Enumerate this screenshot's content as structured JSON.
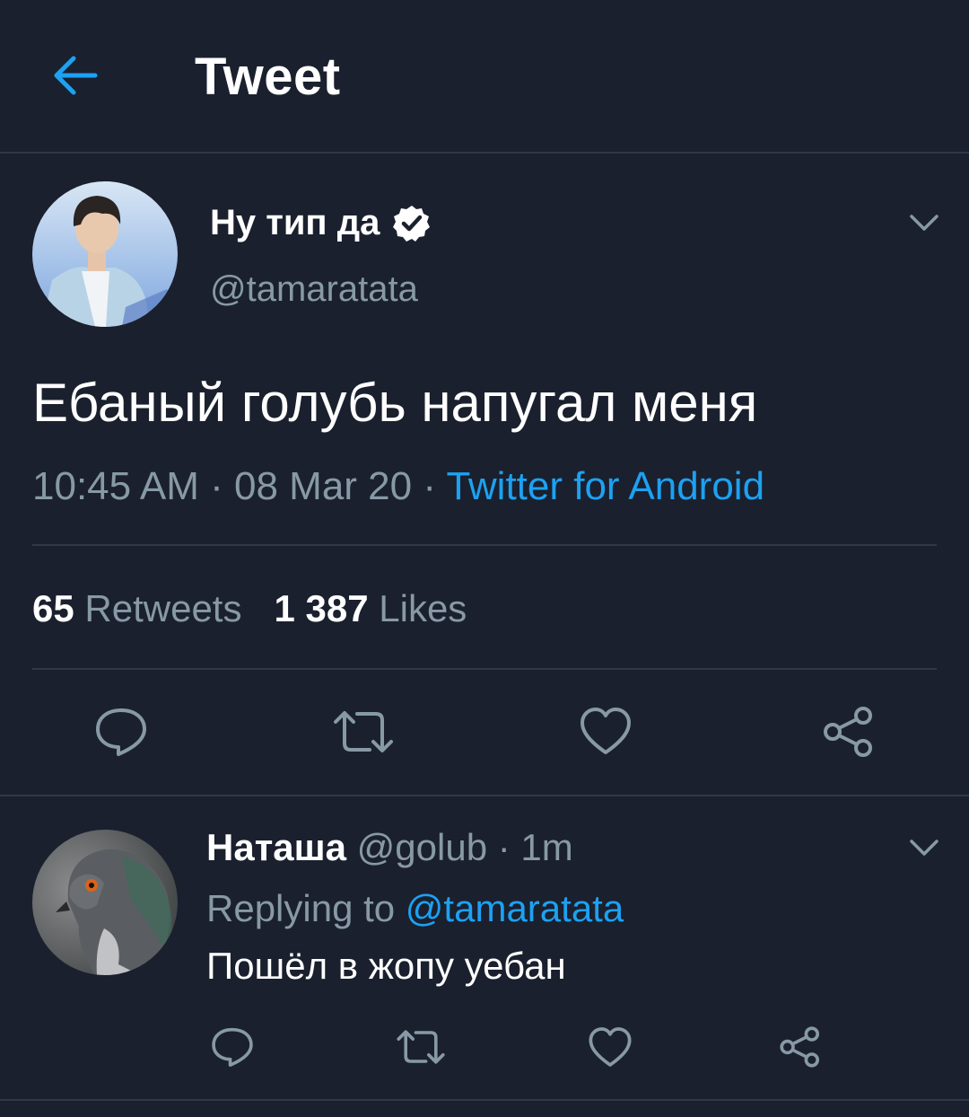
{
  "header": {
    "title": "Tweet",
    "back_icon": "arrow-left-icon"
  },
  "colors": {
    "background": "#1a202e",
    "accent": "#1da1f2",
    "muted": "#8899a6",
    "divider": "#2f3947"
  },
  "tweet": {
    "display_name": "Ну тип да",
    "verified_icon": "verified-badge-icon",
    "handle": "@tamaratata",
    "text": "Ебаный голубь напугал меня",
    "time": "10:45 AM",
    "date": "08 Mar 20",
    "source": "Twitter for Android",
    "separator": " · ",
    "retweets_count": "65",
    "retweets_label": "Retweets",
    "likes_count": "1 387",
    "likes_label": "Likes",
    "actions": [
      "reply-icon",
      "retweet-icon",
      "like-icon",
      "share-icon"
    ]
  },
  "reply": {
    "display_name": "Наташа",
    "handle": "@golub",
    "time": "1m",
    "replying_prefix": "Replying to",
    "replying_to": "@tamaratata",
    "text": "Пошёл в жопу уебан",
    "actions": [
      "reply-icon",
      "retweet-icon",
      "like-icon",
      "share-icon"
    ]
  }
}
